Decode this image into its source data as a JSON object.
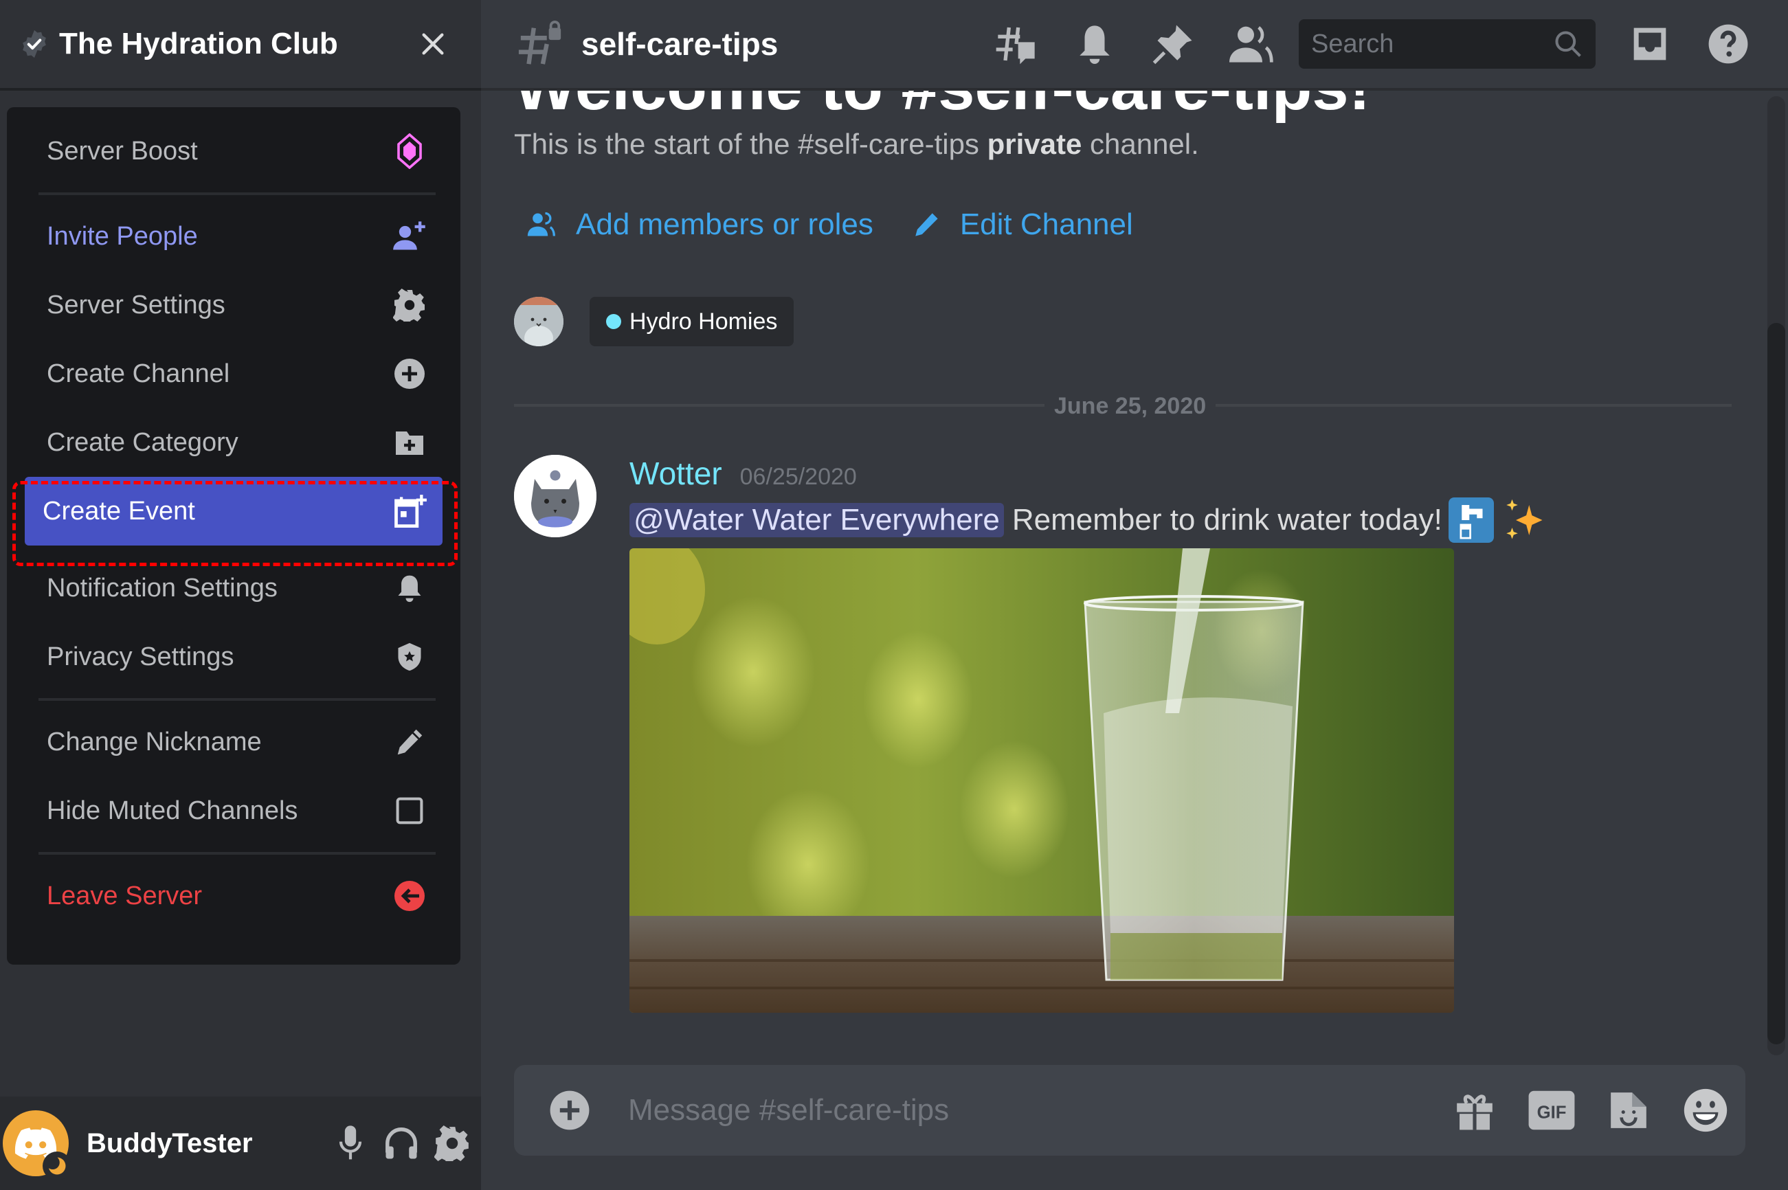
{
  "server": {
    "name": "The Hydration Club",
    "verified_icon": "verified-badge-icon",
    "close_icon": "close-icon"
  },
  "menu": {
    "items": [
      {
        "label": "Server Boost",
        "icon": "boost-gem-icon",
        "style": "normal"
      },
      {
        "label": "Invite People",
        "icon": "add-user-icon",
        "style": "accent"
      },
      {
        "label": "Server Settings",
        "icon": "gear-icon",
        "style": "normal"
      },
      {
        "label": "Create Channel",
        "icon": "plus-circle-icon",
        "style": "normal"
      },
      {
        "label": "Create Category",
        "icon": "folder-plus-icon",
        "style": "normal"
      },
      {
        "label": "Create Event",
        "icon": "calendar-plus-icon",
        "style": "active"
      },
      {
        "label": "Notification Settings",
        "icon": "bell-icon",
        "style": "normal"
      },
      {
        "label": "Privacy Settings",
        "icon": "shield-star-icon",
        "style": "normal"
      },
      {
        "label": "Change Nickname",
        "icon": "pencil-icon",
        "style": "normal"
      },
      {
        "label": "Hide Muted Channels",
        "icon": "checkbox-icon",
        "style": "normal",
        "checked": false
      },
      {
        "label": "Leave Server",
        "icon": "leave-arrow-icon",
        "style": "danger"
      }
    ],
    "highlighted_item": "Create Event"
  },
  "user": {
    "name": "BuddyTester",
    "status": "idle",
    "controls": [
      "microphone-icon",
      "headphones-icon",
      "settings-gear-icon"
    ]
  },
  "channel": {
    "name": "self-care-tips",
    "type": "private-text",
    "toolbar_icons": [
      "threads-icon",
      "notification-bell-icon",
      "pin-icon",
      "member-list-icon",
      "inbox-icon",
      "help-icon"
    ],
    "search_placeholder": "Search"
  },
  "welcome": {
    "heading": "Welcome to #self-care-tips!",
    "intro_prefix": "This is the start of the #self-care-tips ",
    "intro_bold": "private",
    "intro_suffix": " channel.",
    "actions": [
      {
        "label": "Add members or roles",
        "icon": "add-members-icon"
      },
      {
        "label": "Edit Channel",
        "icon": "edit-pencil-icon"
      }
    ],
    "role": {
      "name": "Hydro Homies",
      "color": "#74e5fb"
    }
  },
  "date_divider": "June 25, 2020",
  "message": {
    "author": "Wotter",
    "author_color": "#74e5fb",
    "timestamp": "06/25/2020",
    "mention": "@Water Water Everywhere",
    "text": "Remember to drink water today!",
    "emojis": [
      "potable-water-emoji",
      "sparkles-emoji"
    ],
    "attachment": "image: water pouring into a glass on a wooden table"
  },
  "composer": {
    "placeholder": "Message #self-care-tips",
    "icons": [
      "gift-icon",
      "gif-icon",
      "sticker-icon",
      "emoji-icon"
    ],
    "gif_label": "GIF"
  },
  "colors": {
    "accent": "#4752c4",
    "link": "#3fa6ed",
    "danger": "#ed4245",
    "boost": "#ff73fa"
  }
}
